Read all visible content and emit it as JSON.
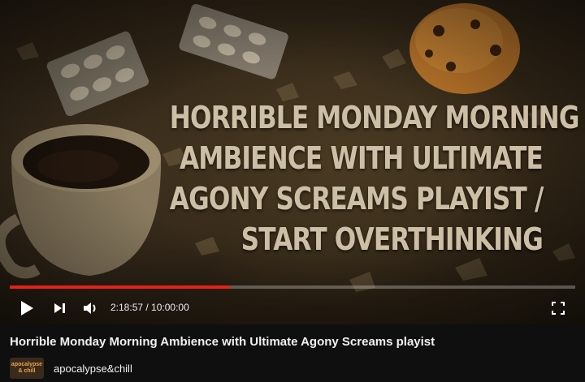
{
  "video": {
    "overlay_title_lines": [
      "HORRIBLE MONDAY MORNING",
      "AMBIENCE WITH ULTIMATE",
      "AGONY SCREAMS PLAYIST /",
      "START OVERTHINKING"
    ],
    "title": "Horrible Monday Morning Ambience with Ultimate Agony Screams playist"
  },
  "player": {
    "current_time": "2:18:57",
    "duration": "10:00:00",
    "time_display": "2:18:57 / 10:00:00",
    "progress_fraction": 0.39,
    "accent_color": "#e62117",
    "icons": [
      "play-icon",
      "next-icon",
      "volume-icon",
      "fullscreen-icon"
    ]
  },
  "channel": {
    "name": "apocalypse&chill",
    "avatar_text_line1": "apocalypse",
    "avatar_text_line2": "& chill"
  }
}
